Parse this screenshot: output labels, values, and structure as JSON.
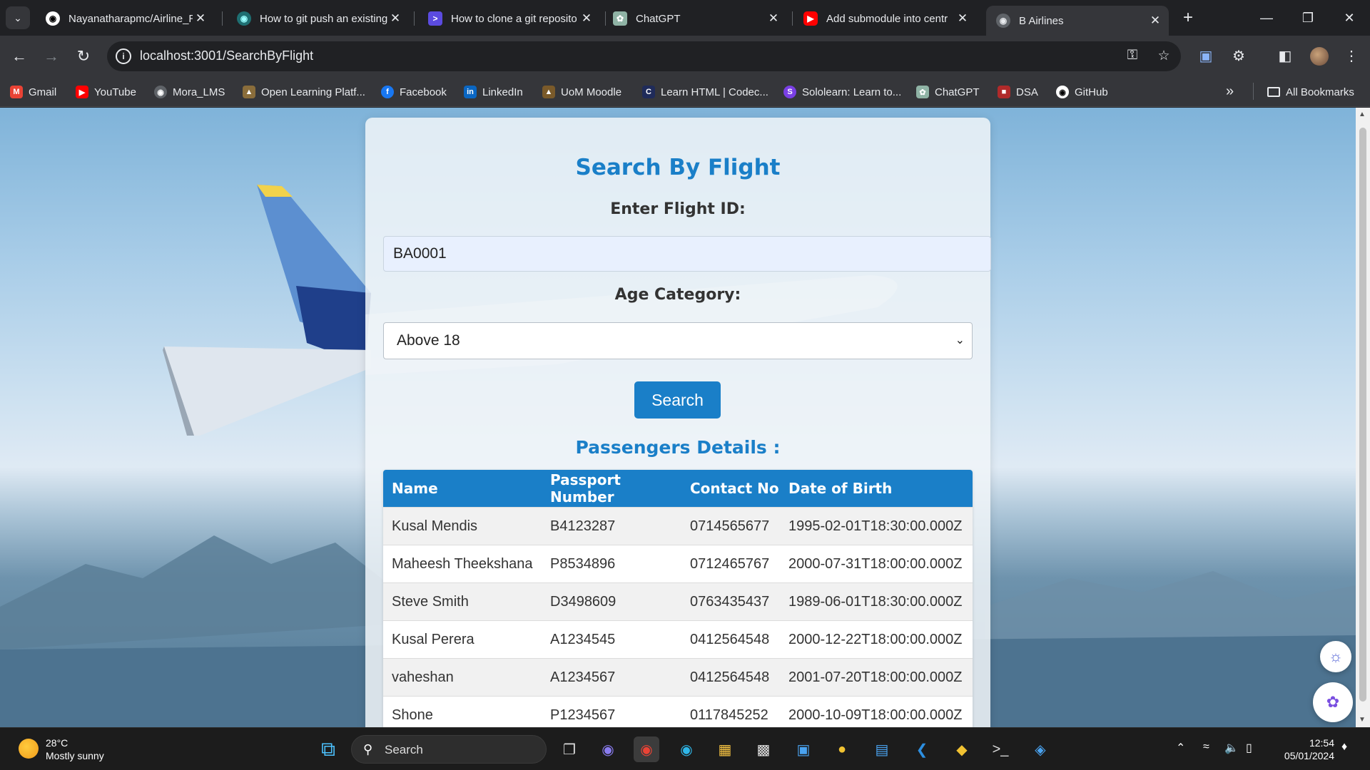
{
  "browser": {
    "tabs": [
      {
        "title": "Nayanatharapmc/Airline_R",
        "icon": "github-icon"
      },
      {
        "title": "How to git push an existing",
        "icon": "web-icon"
      },
      {
        "title": "How to clone a git reposito",
        "icon": "terminal-icon"
      },
      {
        "title": "ChatGPT",
        "icon": "chatgpt-icon"
      },
      {
        "title": "Add submodule into centr",
        "icon": "youtube-icon"
      },
      {
        "title": "B Airlines",
        "icon": "globe-icon"
      }
    ],
    "active_tab": 5,
    "url": "localhost:3001/SearchByFlight",
    "bookmarks": [
      {
        "label": "Gmail",
        "icon": "gmail-icon"
      },
      {
        "label": "YouTube",
        "icon": "youtube-icon"
      },
      {
        "label": "Mora_LMS",
        "icon": "globe-icon"
      },
      {
        "label": "Open Learning Platf...",
        "icon": "open-learning-icon"
      },
      {
        "label": "Facebook",
        "icon": "facebook-icon"
      },
      {
        "label": "LinkedIn",
        "icon": "linkedin-icon"
      },
      {
        "label": "UoM Moodle",
        "icon": "moodle-icon"
      },
      {
        "label": "Learn HTML | Codec...",
        "icon": "codecademy-icon"
      },
      {
        "label": "Sololearn: Learn to...",
        "icon": "sololearn-icon"
      },
      {
        "label": "ChatGPT",
        "icon": "chatgpt-icon"
      },
      {
        "label": "DSA",
        "icon": "dsa-icon"
      },
      {
        "label": "GitHub",
        "icon": "github-icon"
      }
    ],
    "all_bookmarks": "All Bookmarks"
  },
  "page": {
    "title": "Search By Flight",
    "flight_label": "Enter Flight ID:",
    "flight_value": "BA0001",
    "age_label": "Age Category:",
    "age_value": "Above 18",
    "search_button": "Search",
    "passengers_title": "Passengers Details :",
    "table": {
      "headers": [
        "Name",
        "Passport Number",
        "Contact No",
        "Date of Birth"
      ],
      "rows": [
        [
          "Kusal Mendis",
          "B4123287",
          "0714565677",
          "1995-02-01T18:30:00.000Z"
        ],
        [
          "Maheesh Theekshana",
          "P8534896",
          "0712465767",
          "2000-07-31T18:00:00.000Z"
        ],
        [
          "Steve Smith",
          "D3498609",
          "0763435437",
          "1989-06-01T18:30:00.000Z"
        ],
        [
          "Kusal Perera",
          "A1234545",
          "0412564548",
          "2000-12-22T18:00:00.000Z"
        ],
        [
          "vaheshan",
          "A1234567",
          "0412564548",
          "2001-07-20T18:00:00.000Z"
        ],
        [
          "Shone",
          "P1234567",
          "0117845252",
          "2000-10-09T18:00:00.000Z"
        ]
      ]
    }
  },
  "taskbar": {
    "temperature": "28°C",
    "weather": "Mostly sunny",
    "search": "Search",
    "time": "12:54",
    "date": "05/01/2024"
  },
  "colors": {
    "accent": "#1a7fc8",
    "browser_dark": "#202124",
    "browser_toolbar": "#35363a"
  }
}
